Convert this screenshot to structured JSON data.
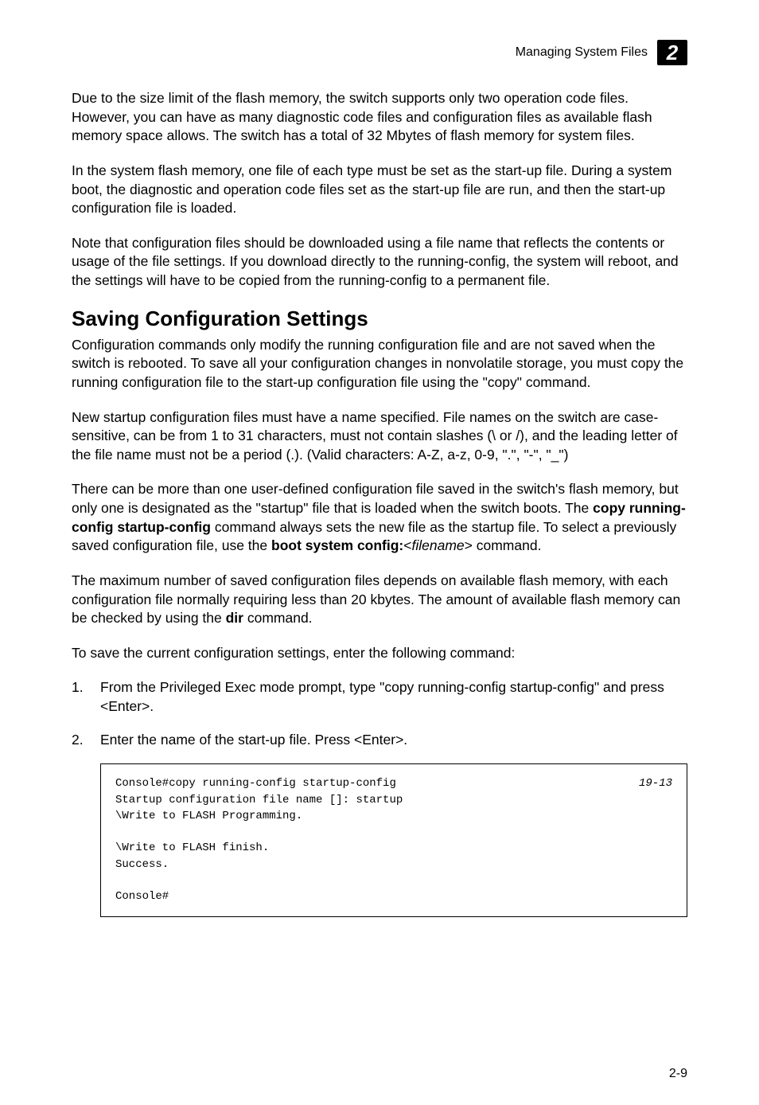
{
  "header": {
    "title": "Managing System Files",
    "badge": "2"
  },
  "paragraphs": {
    "p1": "Due to the size limit of the flash memory, the switch supports only two operation code files. However, you can have as many diagnostic code files and configuration files as available flash memory space allows. The switch has a total of 32 Mbytes of flash memory for system files.",
    "p2": "In the system flash memory, one file of each type must be set as the start-up file. During a system boot, the diagnostic and operation code files set as the start-up file are run, and then the start-up configuration file is loaded.",
    "p3": "Note that configuration files should be downloaded using a file name that reflects the contents or usage of the file settings. If you download directly to the running-config, the system will reboot, and the settings will have to be copied from the running-config to a permanent file."
  },
  "section": {
    "heading": "Saving Configuration Settings",
    "p4": "Configuration commands only modify the running configuration file and are not saved when the switch is rebooted. To save all your configuration changes in nonvolatile storage, you must copy the running configuration file to the start-up configuration file using the \"copy\" command.",
    "p5": "New startup configuration files must have a name specified. File names on the switch are case-sensitive, can be from 1 to 31 characters, must not contain slashes (\\ or /), and the leading letter of the file name must not be a period (.). (Valid characters: A-Z, a-z, 0-9, \".\", \"-\", \"_\")",
    "p6_part1": "There can be more than one user-defined configuration file saved in the switch's flash memory, but only one is designated as the \"startup\" file that is loaded when the switch boots. The ",
    "p6_bold1": "copy running-config startup-config",
    "p6_part2": " command always sets the new file as the startup file. To select a previously saved configuration file, use the ",
    "p6_bold2": "boot system config:",
    "p6_italic": "filename",
    "p6_part3": "> command.",
    "p6_lt": "<",
    "p7_part1": "The maximum number of saved configuration files depends on available flash memory, with each configuration file normally requiring less than 20 kbytes. The amount of available flash memory can be checked by using the ",
    "p7_bold": "dir",
    "p7_part2": " command.",
    "p8": "To save the current configuration settings, enter the following command:",
    "step1_num": "1.",
    "step1": "From the Privileged Exec mode prompt, type \"copy running-config startup-config\" and press <Enter>.",
    "step2_num": "2.",
    "step2": "Enter the name of the start-up file. Press <Enter>."
  },
  "code": {
    "body": "Console#copy running-config startup-config\nStartup configuration file name []: startup\n\\Write to FLASH Programming.\n\n\\Write to FLASH finish.\nSuccess.\n\nConsole#",
    "ref": "19-13"
  },
  "footer": {
    "page": "2-9"
  }
}
